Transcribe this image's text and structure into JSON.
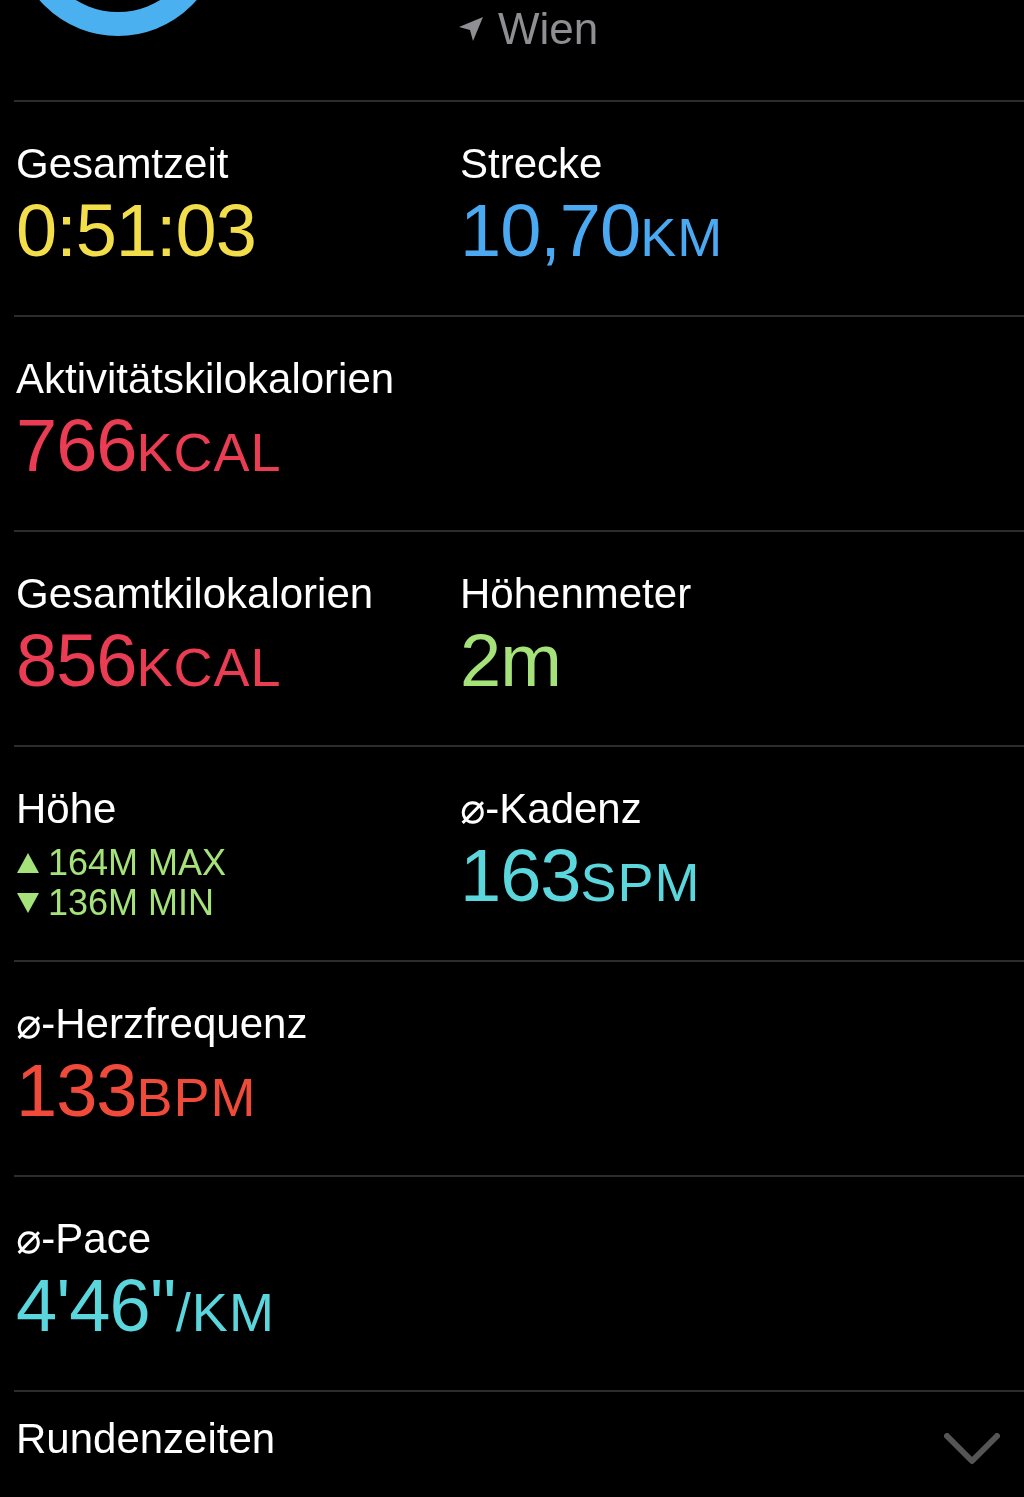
{
  "location": {
    "name": "Wien"
  },
  "rows": [
    {
      "metrics": [
        {
          "kind": "value",
          "label": "Gesamtzeit",
          "value": "0:51:03",
          "color": "#f2de4b"
        },
        {
          "kind": "value",
          "label": "Strecke",
          "value": "10,70",
          "unit": "KM",
          "color": "#4ba9f2"
        }
      ]
    },
    {
      "metrics": [
        {
          "kind": "value",
          "label": "Aktivitätskilokalorien",
          "value": "766",
          "unit": "KCAL",
          "color": "#ea3c52"
        }
      ]
    },
    {
      "metrics": [
        {
          "kind": "value",
          "label": "Gesamtkilokalorien",
          "value": "856",
          "unit": "KCAL",
          "color": "#ea3c52"
        },
        {
          "kind": "value",
          "label": "Höhenmeter",
          "value": "2m",
          "color": "#a6e27a"
        }
      ]
    },
    {
      "metrics": [
        {
          "kind": "range",
          "label": "Höhe",
          "color": "#a6e27a",
          "lines": [
            {
              "kind": "up",
              "text": "164M MAX"
            },
            {
              "kind": "down",
              "text": "136M MIN"
            }
          ]
        },
        {
          "kind": "value",
          "label": "⌀-Kadenz",
          "value": "163",
          "unit": "SPM",
          "color": "#5ad6dc"
        }
      ]
    },
    {
      "metrics": [
        {
          "kind": "value",
          "label": "⌀-Herzfrequenz",
          "value": "133",
          "unit": "BPM",
          "color": "#f04b3a"
        }
      ]
    },
    {
      "metrics": [
        {
          "kind": "value",
          "label": "⌀-Pace",
          "value": "4'46''",
          "unit": "/KM",
          "color": "#5ad6dc"
        }
      ]
    }
  ],
  "footer": {
    "label": "Rundenzeiten",
    "expanded": false
  }
}
